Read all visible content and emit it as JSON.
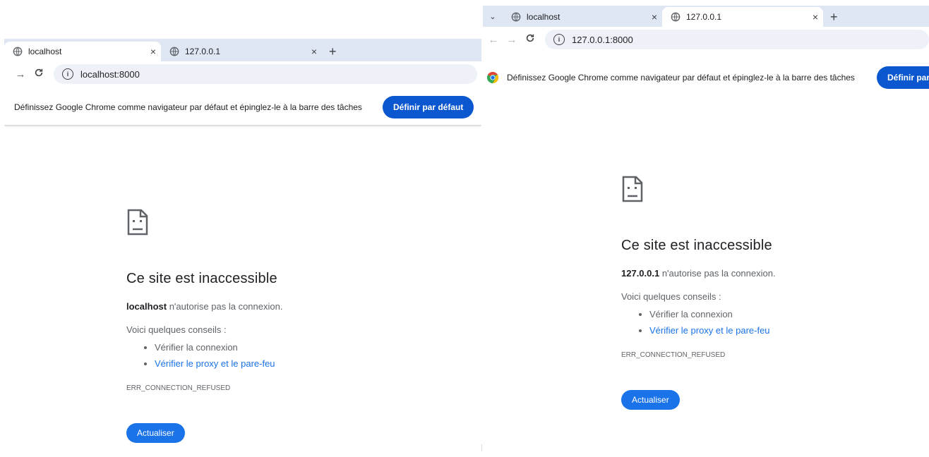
{
  "left": {
    "tabs": [
      {
        "title": "localhost",
        "close": "×"
      },
      {
        "title": "127.0.0.1",
        "close": "×"
      }
    ],
    "new_tab": "+",
    "url": "localhost:8000",
    "infobar": {
      "message": "Définissez Google Chrome comme navigateur par défaut et épinglez-le à la barre des tâches",
      "button": "Définir par défaut"
    },
    "error": {
      "title": "Ce site est inaccessible",
      "host": "localhost",
      "host_suffix": " n'autorise pas la connexion.",
      "suggestions_heading": "Voici quelques conseils :",
      "suggestion_1": "Vérifier la connexion",
      "suggestion_2": "Vérifier le proxy et le pare-feu",
      "code": "ERR_CONNECTION_REFUSED",
      "reload": "Actualiser"
    }
  },
  "right": {
    "tab_menu": "⌄",
    "tabs": [
      {
        "title": "localhost",
        "close": "×"
      },
      {
        "title": "127.0.0.1",
        "close": "×"
      }
    ],
    "new_tab": "+",
    "url": "127.0.0.1:8000",
    "infobar": {
      "message": "Définissez Google Chrome comme navigateur par défaut et épinglez-le à la barre des tâches",
      "button": "Définir par défaut"
    },
    "error": {
      "title": "Ce site est inaccessible",
      "host": "127.0.0.1",
      "host_suffix": " n'autorise pas la connexion.",
      "suggestions_heading": "Voici quelques conseils :",
      "suggestion_1": "Vérifier la connexion",
      "suggestion_2": "Vérifier le proxy et le pare-feu",
      "code": "ERR_CONNECTION_REFUSED",
      "reload": "Actualiser"
    }
  },
  "icons": {
    "tab_favicon": "globe-icon",
    "back": "back-arrow-icon",
    "forward": "forward-arrow-icon",
    "reload": "reload-icon",
    "site_info": "info-icon",
    "error": "sad-document-icon",
    "chrome": "chrome-logo-icon"
  },
  "colors": {
    "accent": "#0b57d0",
    "link": "#1a73e8",
    "tabstrip": "#dfe6f4",
    "omnibox": "#eef1f7"
  }
}
